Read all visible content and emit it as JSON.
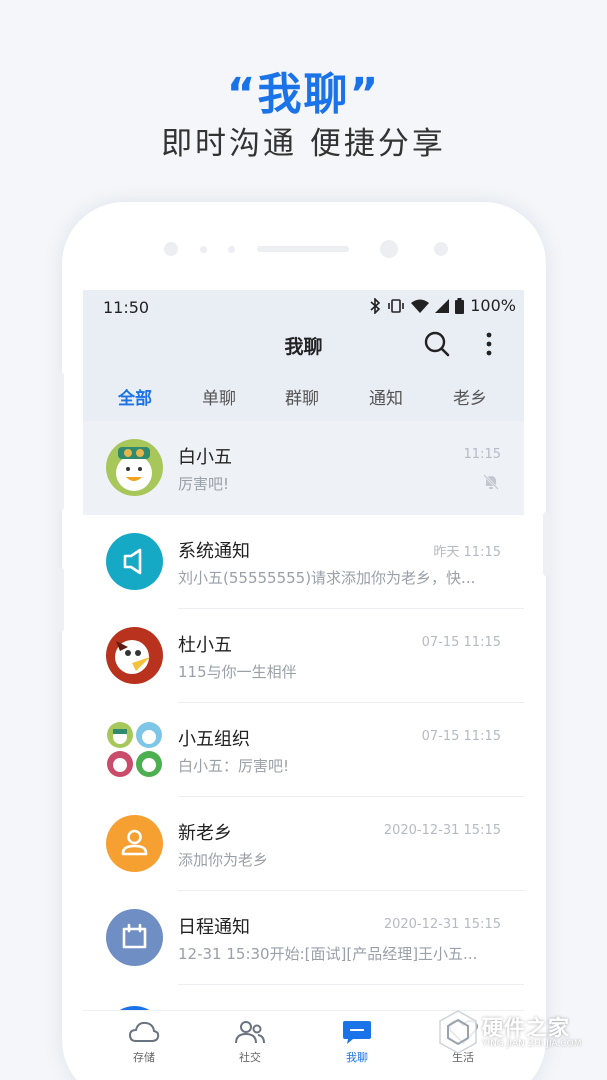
{
  "promo": {
    "title": "“我聊”",
    "subtitle": "即时沟通 便捷分享"
  },
  "status_bar": {
    "time": "11:50",
    "battery": "100%",
    "icons": [
      "bluetooth-icon",
      "vibrate-icon",
      "wifi-icon",
      "signal-icon",
      "battery-icon"
    ]
  },
  "header": {
    "title": "我聊",
    "icons": [
      "search-icon",
      "more-vertical-icon"
    ]
  },
  "tabs": [
    {
      "label": "全部",
      "active": true
    },
    {
      "label": "单聊",
      "active": false
    },
    {
      "label": "群聊",
      "active": false
    },
    {
      "label": "通知",
      "active": false
    },
    {
      "label": "老乡",
      "active": false
    }
  ],
  "chats": [
    {
      "name": "白小五",
      "time": "11:15",
      "preview": "厉害吧!",
      "muted": true,
      "avatar": "cartoon-bird-avatar"
    },
    {
      "name": "系统通知",
      "time": "昨天 11:15",
      "preview": "刘小五(55555555)请求添加你为老乡，快...",
      "avatar": "speaker-icon",
      "avatar_color": "#16a9c6"
    },
    {
      "name": "杜小五",
      "time": "07-15 11:15",
      "preview": "115与你一生相伴",
      "avatar": "cartoon-bird-avatar"
    },
    {
      "name": "小五组织",
      "time": "07-15 11:15",
      "preview": "白小五：厉害吧!",
      "avatar": "group-avatar"
    },
    {
      "name": "新老乡",
      "time": "2020-12-31 15:15",
      "preview": "添加你为老乡",
      "avatar": "person-icon",
      "avatar_color": "#f5a030"
    },
    {
      "name": "日程通知",
      "time": "2020-12-31 15:15",
      "preview": "12-31 15:30开始:[面试][产品经理]王小五...",
      "avatar": "calendar-icon",
      "avatar_color": "#6f8fc4"
    }
  ],
  "bottom_nav": [
    {
      "label": "存储",
      "icon": "cloud-icon",
      "active": false
    },
    {
      "label": "社交",
      "icon": "people-icon",
      "active": false
    },
    {
      "label": "我聊",
      "icon": "chat-bubble-icon",
      "active": true
    },
    {
      "label": "生活",
      "icon": "heart-icon",
      "active": false
    }
  ],
  "watermark": {
    "text": "硬件之家",
    "sub": "YING JIAN ZHI JIA.COM"
  },
  "colors": {
    "accent": "#1a73e8",
    "background": "#f4f6f9",
    "header_bg": "#e9eef5"
  }
}
